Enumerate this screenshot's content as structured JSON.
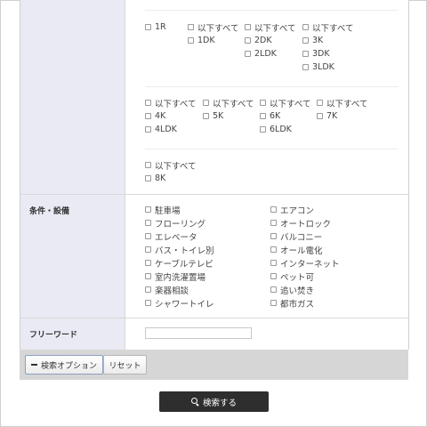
{
  "layout_opts": {
    "row1": [
      {
        "label": "1R",
        "checked": false
      },
      {
        "label": "以下すべて",
        "checked": false
      },
      {
        "label": "1DK",
        "checked": false
      },
      {
        "label": "以下すべて",
        "checked": false
      },
      {
        "label": "2DK",
        "checked": false
      },
      {
        "label": "2LDK",
        "checked": false
      },
      {
        "label": "以下すべて",
        "checked": false
      },
      {
        "label": "3K",
        "checked": false
      },
      {
        "label": "3DK",
        "checked": false
      },
      {
        "label": "3LDK",
        "checked": false
      }
    ],
    "row2": [
      {
        "label": "以下すべて",
        "checked": false
      },
      {
        "label": "4K",
        "checked": false
      },
      {
        "label": "4LDK",
        "checked": false
      },
      {
        "label": "以下すべて",
        "checked": false
      },
      {
        "label": "5K",
        "checked": false
      },
      {
        "label": "以下すべて",
        "checked": false
      },
      {
        "label": "6K",
        "checked": false
      },
      {
        "label": "6LDK",
        "checked": false
      },
      {
        "label": "以下すべて",
        "checked": false
      },
      {
        "label": "7K",
        "checked": false
      }
    ],
    "row3": [
      {
        "label": "以下すべて",
        "checked": false
      },
      {
        "label": "8K",
        "checked": false
      }
    ]
  },
  "conditions": {
    "label": "条件・設備",
    "left": [
      "駐車場",
      "フローリング",
      "エレベータ",
      "バス・トイレ別",
      "ケーブルテレビ",
      "室内洗濯置場",
      "楽器相談",
      "シャワートイレ"
    ],
    "right": [
      "エアコン",
      "オートロック",
      "バルコニー",
      "オール電化",
      "インターネット",
      "ペット可",
      "追い焚き",
      "都市ガス"
    ]
  },
  "free_word": {
    "label": "フリーワード",
    "value": "",
    "placeholder": ""
  },
  "buttons": {
    "search_options": "検索オプション",
    "reset": "リセット",
    "search": "検索する"
  }
}
